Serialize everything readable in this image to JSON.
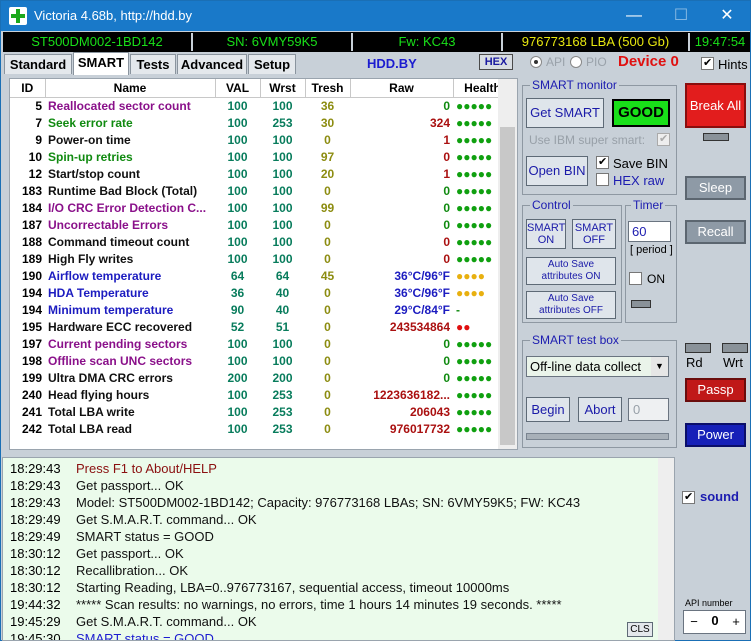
{
  "window": {
    "title": "Victoria 4.68b, http://hdd.by",
    "min": "—",
    "max": "☐",
    "close": "✕"
  },
  "infobar": {
    "model": "ST500DM002-1BD142",
    "serial": "SN: 6VMY59K5",
    "firmware": "Fw: KC43",
    "lba": "976773168 LBA (500 Gb)",
    "clock": "19:47:54"
  },
  "tabs": [
    "Standard",
    "SMART",
    "Tests",
    "Advanced",
    "Setup"
  ],
  "active_tab": "SMART",
  "toolbar": {
    "site": "HDD.BY",
    "hex": "HEX",
    "api": "API",
    "pio": "PIO",
    "device": "Device 0",
    "hints": "Hints"
  },
  "smart_table": {
    "headers": [
      "ID",
      "Name",
      "VAL",
      "Wrst",
      "Tresh",
      "Raw",
      "Health"
    ],
    "rows": [
      {
        "id": "5",
        "name": "Reallocated sector count",
        "val": "100",
        "wrst": "100",
        "tresh": "36",
        "raw": "0",
        "health": "●●●●●",
        "name_color": "#8a108a",
        "raw_color": "#108a10",
        "health_color": "#10a010"
      },
      {
        "id": "7",
        "name": "Seek error rate",
        "val": "100",
        "wrst": "253",
        "tresh": "30",
        "raw": "324",
        "health": "●●●●●",
        "name_color": "#108a10",
        "raw_color": "#aa1010",
        "health_color": "#10a010"
      },
      {
        "id": "9",
        "name": "Power-on time",
        "val": "100",
        "wrst": "100",
        "tresh": "0",
        "raw": "1",
        "health": "●●●●●",
        "name_color": "#101010",
        "raw_color": "#aa1010",
        "health_color": "#10a010"
      },
      {
        "id": "10",
        "name": "Spin-up retries",
        "val": "100",
        "wrst": "100",
        "tresh": "97",
        "raw": "0",
        "health": "●●●●●",
        "name_color": "#108a10",
        "raw_color": "#aa1010",
        "health_color": "#10a010"
      },
      {
        "id": "12",
        "name": "Start/stop count",
        "val": "100",
        "wrst": "100",
        "tresh": "20",
        "raw": "1",
        "health": "●●●●●",
        "name_color": "#101010",
        "raw_color": "#aa1010",
        "health_color": "#10a010"
      },
      {
        "id": "183",
        "name": "Runtime Bad Block (Total)",
        "val": "100",
        "wrst": "100",
        "tresh": "0",
        "raw": "0",
        "health": "●●●●●",
        "name_color": "#101010",
        "raw_color": "#108a10",
        "health_color": "#10a010"
      },
      {
        "id": "184",
        "name": "I/O CRC Error Detection C...",
        "val": "100",
        "wrst": "100",
        "tresh": "99",
        "raw": "0",
        "health": "●●●●●",
        "name_color": "#8a108a",
        "raw_color": "#108a10",
        "health_color": "#10a010"
      },
      {
        "id": "187",
        "name": "Uncorrectable Errors",
        "val": "100",
        "wrst": "100",
        "tresh": "0",
        "raw": "0",
        "health": "●●●●●",
        "name_color": "#8a108a",
        "raw_color": "#108a10",
        "health_color": "#10a010"
      },
      {
        "id": "188",
        "name": "Command timeout count",
        "val": "100",
        "wrst": "100",
        "tresh": "0",
        "raw": "0",
        "health": "●●●●●",
        "name_color": "#101010",
        "raw_color": "#aa1010",
        "health_color": "#10a010"
      },
      {
        "id": "189",
        "name": "High Fly writes",
        "val": "100",
        "wrst": "100",
        "tresh": "0",
        "raw": "0",
        "health": "●●●●●",
        "name_color": "#101010",
        "raw_color": "#aa1010",
        "health_color": "#10a010"
      },
      {
        "id": "190",
        "name": "Airflow temperature",
        "val": "64",
        "wrst": "64",
        "tresh": "45",
        "raw": "36°C/96°F",
        "health": "●●●●",
        "name_color": "#1c1cc0",
        "raw_color": "#1c1cc0",
        "health_color": "#e8b010"
      },
      {
        "id": "194",
        "name": "HDA Temperature",
        "val": "36",
        "wrst": "40",
        "tresh": "0",
        "raw": "36°C/96°F",
        "health": "●●●●",
        "name_color": "#1c1cc0",
        "raw_color": "#1c1cc0",
        "health_color": "#e8b010"
      },
      {
        "id": "194",
        "name": "Minimum temperature",
        "val": "90",
        "wrst": "40",
        "tresh": "0",
        "raw": "29°C/84°F",
        "health": "-",
        "name_color": "#1c1cc0",
        "raw_color": "#1c1cc0",
        "health_color": "#108a10"
      },
      {
        "id": "195",
        "name": "Hardware ECC recovered",
        "val": "52",
        "wrst": "51",
        "tresh": "0",
        "raw": "243534864",
        "health": "●●",
        "name_color": "#101010",
        "raw_color": "#aa1010",
        "health_color": "#e01010"
      },
      {
        "id": "197",
        "name": "Current pending sectors",
        "val": "100",
        "wrst": "100",
        "tresh": "0",
        "raw": "0",
        "health": "●●●●●",
        "name_color": "#8a108a",
        "raw_color": "#108a10",
        "health_color": "#10a010"
      },
      {
        "id": "198",
        "name": "Offline scan UNC sectors",
        "val": "100",
        "wrst": "100",
        "tresh": "0",
        "raw": "0",
        "health": "●●●●●",
        "name_color": "#8a108a",
        "raw_color": "#108a10",
        "health_color": "#10a010"
      },
      {
        "id": "199",
        "name": "Ultra DMA CRC errors",
        "val": "200",
        "wrst": "200",
        "tresh": "0",
        "raw": "0",
        "health": "●●●●●",
        "name_color": "#101010",
        "raw_color": "#108a10",
        "health_color": "#10a010"
      },
      {
        "id": "240",
        "name": "Head flying hours",
        "val": "100",
        "wrst": "253",
        "tresh": "0",
        "raw": "1223636182...",
        "health": "●●●●●",
        "name_color": "#101010",
        "raw_color": "#aa1010",
        "health_color": "#10a010"
      },
      {
        "id": "241",
        "name": "Total LBA write",
        "val": "100",
        "wrst": "253",
        "tresh": "0",
        "raw": "206043",
        "health": "●●●●●",
        "name_color": "#101010",
        "raw_color": "#aa1010",
        "health_color": "#10a010"
      },
      {
        "id": "242",
        "name": "Total LBA read",
        "val": "100",
        "wrst": "253",
        "tresh": "0",
        "raw": "976017732",
        "health": "●●●●●",
        "name_color": "#101010",
        "raw_color": "#aa1010",
        "health_color": "#10a010"
      }
    ]
  },
  "smart_monitor": {
    "title": "SMART monitor",
    "get_smart": "Get SMART",
    "status": "GOOD",
    "ibm_label": "Use IBM super smart:",
    "open_bin": "Open BIN",
    "save_bin": "Save BIN",
    "hex_raw": "HEX raw"
  },
  "control": {
    "title": "Control",
    "smart_on": "SMART ON",
    "smart_off": "SMART OFF",
    "autosave_on": "Auto Save attributes ON",
    "autosave_off": "Auto Save attributes OFF"
  },
  "timer": {
    "title": "Timer",
    "value": "60",
    "period": "[ period ]",
    "on": "ON"
  },
  "test_box": {
    "title": "SMART test box",
    "selected": "Off-line data collect",
    "begin": "Begin",
    "abort": "Abort",
    "number": "0"
  },
  "side": {
    "break_all": "Break All",
    "sleep": "Sleep",
    "recall": "Recall",
    "rd": "Rd",
    "wrt": "Wrt",
    "passp": "Passp",
    "power": "Power",
    "sound": "sound",
    "api_number_label": "API number",
    "api_number": "0",
    "minus": "−",
    "plus": "+"
  },
  "log": {
    "cls": "CLS",
    "lines": [
      {
        "time": "18:29:43",
        "text": "Press F1 to About/HELP",
        "color": "#8a1010"
      },
      {
        "time": "18:29:43",
        "text": "Get passport... OK",
        "color": "#101010"
      },
      {
        "time": "18:29:43",
        "text": "Model: ST500DM002-1BD142; Capacity: 976773168 LBAs; SN: 6VMY59K5; FW: KC43",
        "color": "#101010"
      },
      {
        "time": "18:29:49",
        "text": "Get S.M.A.R.T. command... OK",
        "color": "#101010"
      },
      {
        "time": "18:29:49",
        "text": "SMART status = GOOD",
        "color": "#101010"
      },
      {
        "time": "18:30:12",
        "text": "Get passport... OK",
        "color": "#101010"
      },
      {
        "time": "18:30:12",
        "text": "Recallibration... OK",
        "color": "#101010"
      },
      {
        "time": "18:30:12",
        "text": "Starting Reading, LBA=0..976773167, sequential access, timeout 10000ms",
        "color": "#101010"
      },
      {
        "time": "19:44:32",
        "text": "***** Scan results: no warnings, no errors, time 1 hours 14 minutes 19 seconds.  *****",
        "color": "#101010"
      },
      {
        "time": "19:45:29",
        "text": "Get S.M.A.R.T. command... OK",
        "color": "#101010"
      },
      {
        "time": "19:45:30",
        "text": "SMART status = GOOD",
        "color": "#1c1cd0"
      }
    ]
  }
}
